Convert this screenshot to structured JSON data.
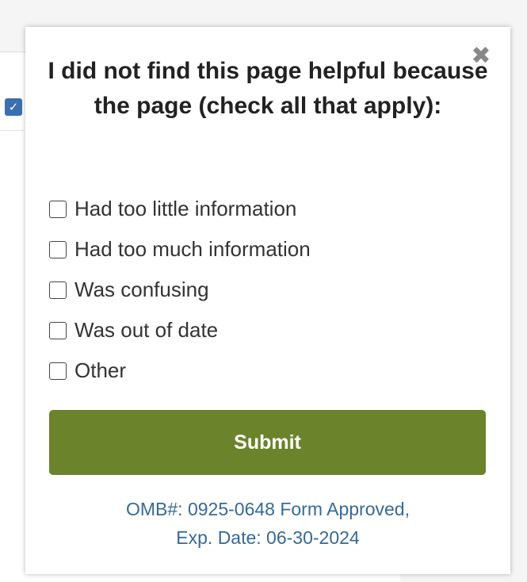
{
  "popup": {
    "close_icon": "✖",
    "title": "I did not find this page helpful because the page (check all that apply):",
    "options": [
      {
        "label": "Had too little information",
        "checked": false
      },
      {
        "label": "Had too much information",
        "checked": false
      },
      {
        "label": "Was confusing",
        "checked": false
      },
      {
        "label": "Was out of date",
        "checked": false
      },
      {
        "label": "Other",
        "checked": false
      }
    ],
    "submit_label": "Submit",
    "omb_line1": "OMB#: 0925-0648 Form Approved,",
    "omb_line2": "Exp. Date: 06-30-2024"
  },
  "background": {
    "check_icon": "✓"
  },
  "colors": {
    "submit_bg": "#6b832b",
    "omb_text": "#356a96"
  }
}
